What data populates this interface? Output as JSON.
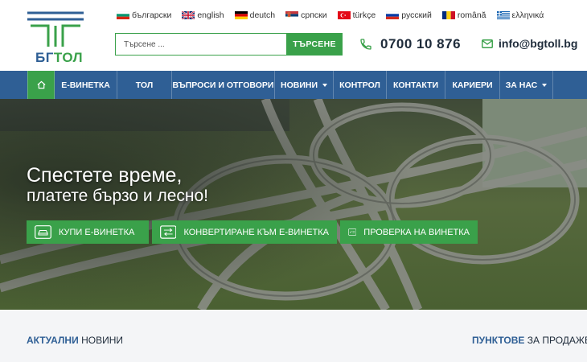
{
  "brand": {
    "name_part1": "БГ",
    "name_part2": "ТОЛ",
    "color_primary": "#2f5f95",
    "color_accent": "#3aa14a"
  },
  "languages": [
    {
      "label": "български",
      "flag": "bg-flag"
    },
    {
      "label": "english",
      "flag": "uk-flag"
    },
    {
      "label": "deutch",
      "flag": "de-flag"
    },
    {
      "label": "српски",
      "flag": "rs-flag"
    },
    {
      "label": "türkçe",
      "flag": "tr-flag"
    },
    {
      "label": "русский",
      "flag": "ru-flag"
    },
    {
      "label": "română",
      "flag": "ro-flag"
    },
    {
      "label": "ελληνικά",
      "flag": "gr-flag"
    }
  ],
  "search": {
    "placeholder": "Търсене ...",
    "button_label": "ТЪРСЕНЕ"
  },
  "contact": {
    "phone": "0700 10 876",
    "email": "info@bgtoll.bg"
  },
  "nav": {
    "items": [
      {
        "label": "Е-ВИНЕТКА",
        "dropdown": false
      },
      {
        "label": "ТОЛ",
        "dropdown": false
      },
      {
        "label": "ВЪПРОСИ И ОТГОВОРИ",
        "dropdown": false
      },
      {
        "label": "НОВИНИ",
        "dropdown": true
      },
      {
        "label": "КОНТРОЛ",
        "dropdown": false
      },
      {
        "label": "КОНТАКТИ",
        "dropdown": false
      },
      {
        "label": "КАРИЕРИ",
        "dropdown": false
      },
      {
        "label": "ЗА НАС",
        "dropdown": true
      }
    ]
  },
  "hero": {
    "title": "Спестете време,",
    "subtitle": "платете бързо и лесно!",
    "buttons": [
      {
        "label": "КУПИ Е-ВИНЕТКА",
        "icon": "car-icon"
      },
      {
        "label": "КОНВЕРТИРАНЕ КЪМ Е-ВИНЕТКА",
        "icon": "convert-icon"
      },
      {
        "label": "ПРОВЕРКА НА ВИНЕТКА",
        "icon": "check-icon"
      }
    ]
  },
  "sections": {
    "news_bold": "АКТУАЛНИ",
    "news_rest": "НОВИНИ",
    "points_bold": "ПУНКТОВЕ",
    "points_rest": "ЗА ПРОДАЖБА"
  }
}
